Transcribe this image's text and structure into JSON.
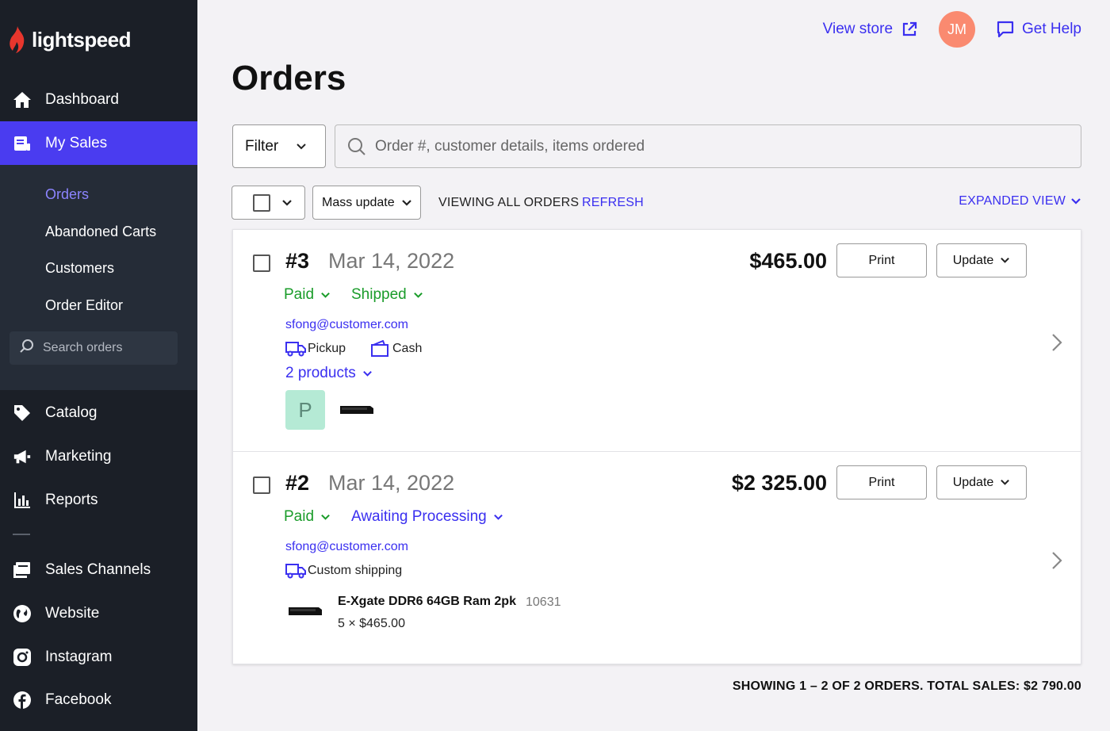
{
  "brand": {
    "name": "lightspeed"
  },
  "sidebar": {
    "items": [
      {
        "label": "Dashboard",
        "icon": "home-icon"
      },
      {
        "label": "My Sales",
        "icon": "receipt-icon",
        "active": true
      },
      {
        "label": "Catalog",
        "icon": "tag-icon"
      },
      {
        "label": "Marketing",
        "icon": "megaphone-icon"
      },
      {
        "label": "Reports",
        "icon": "bar-chart-icon"
      },
      {
        "label": "Sales Channels",
        "icon": "channels-icon"
      },
      {
        "label": "Website",
        "icon": "globe-icon"
      },
      {
        "label": "Instagram",
        "icon": "instagram-icon"
      },
      {
        "label": "Facebook",
        "icon": "facebook-icon"
      }
    ],
    "sub_items": [
      {
        "label": "Orders",
        "active": true
      },
      {
        "label": "Abandoned Carts"
      },
      {
        "label": "Customers"
      },
      {
        "label": "Order Editor"
      }
    ],
    "search_placeholder": "Search orders"
  },
  "header": {
    "view_store": "View store",
    "avatar_initials": "JM",
    "get_help": "Get Help"
  },
  "page": {
    "title": "Orders"
  },
  "toolbar": {
    "filter_label": "Filter",
    "search_placeholder": "Order #, customer details, items ordered",
    "mass_update": "Mass update",
    "viewing": "VIEWING ALL ORDERS",
    "refresh": "REFRESH",
    "expanded_view": "EXPANDED VIEW",
    "print_label": "Print",
    "update_label": "Update"
  },
  "orders": [
    {
      "number": "#3",
      "date": "Mar 14, 2022",
      "total": "$465.00",
      "payment_status": "Paid",
      "fulfillment_status": "Shipped",
      "email": "sfong@customer.com",
      "shipping_method": "Pickup",
      "payment_method": "Cash",
      "products_toggle": "2 products",
      "product_thumb_letter": "P"
    },
    {
      "number": "#2",
      "date": "Mar 14, 2022",
      "total": "$2 325.00",
      "payment_status": "Paid",
      "fulfillment_status": "Awaiting Processing",
      "email": "sfong@customer.com",
      "shipping_method": "Custom shipping",
      "item": {
        "name": "E-Xgate DDR6 64GB Ram 2pk",
        "sku": "10631",
        "qty_price": "5 × $465.00"
      }
    }
  ],
  "summary": "SHOWING 1 – 2 OF 2 ORDERS. TOTAL SALES: $2 790.00",
  "colors": {
    "accent": "#3a2ff0",
    "active_nav": "#4a3cf0",
    "success": "#1a9c2a",
    "avatar": "#fa8a70",
    "sidebar": "#1b1f27"
  }
}
